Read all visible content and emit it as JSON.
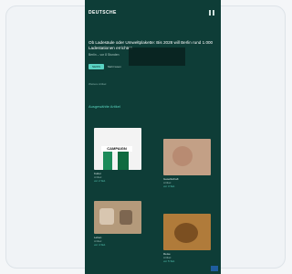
{
  "app": {
    "title": "DEUTSCHE"
  },
  "article": {
    "headline": "Ob Ladesäule oder Umweltplakette: Bis 2028 will Berlin rund 1.000 Ladestationen errichten",
    "byline": "Berlin – vor 8 Stunden",
    "pill_label": "NEWS",
    "pill_text": "Mehr lesen"
  },
  "meta": {
    "small": "Weitere Artikel"
  },
  "section": {
    "title": "Ausgewählte Artikel"
  },
  "tiles": [
    {
      "title": "Kultur",
      "sub": "Artikel",
      "meta": "vor 2 Std."
    },
    {
      "title": "Gesellschaft",
      "sub": "Artikel",
      "meta": "vor 3 Std."
    },
    {
      "title": "Leben",
      "sub": "Artikel",
      "meta": "vor 4 Std."
    },
    {
      "title": "Reise",
      "sub": "Artikel",
      "meta": "vor 5 Std."
    }
  ],
  "thumb_banner": "CAMPAIGN"
}
